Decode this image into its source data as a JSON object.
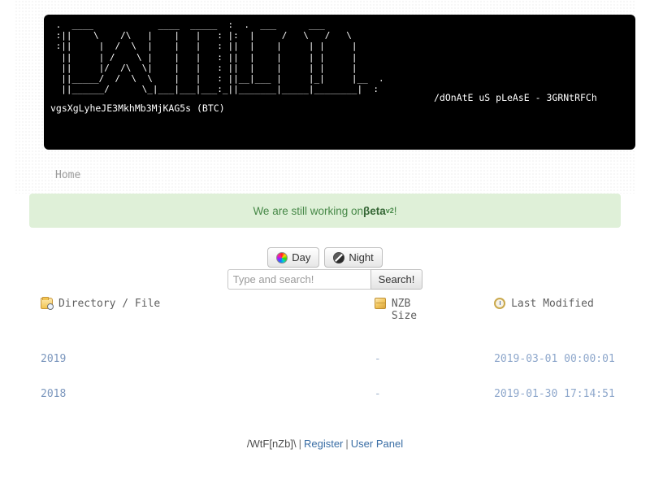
{
  "banner": {
    "ascii_art": " .  ____            ____  _____  :  .  ___      ___ \n :||    \\    /\\   |    |   |   : |:  |     /   \\   /   \\\n :||     |  /  \\  |    |   |   : ||  |    |     | |     |\n  ||     | /    \\ |    |   |   : ||  |    |     | |     |\n  ||     |/  /\\  \\|    |   |   : ||  |    |     | |     |\n  ||_____/  /  \\  \\    |   |   : ||__|___ |     |_|     |__  .\n  ||______/      \\_|___|___|___:_||_______|_____|________|  :",
    "donate_text": "/dOnAtE uS pLeAsE - 3GRNtRFCh",
    "btc_line": "vgsXgLyheJE3MkhMb3MjKAG5s (BTC)",
    "background": "#000000",
    "text_color": "#ffffff"
  },
  "nav": {
    "items": [
      {
        "label": "Home",
        "name": "nav-item-home"
      }
    ]
  },
  "alert": {
    "prefix": "We are still working on ",
    "bold": "βeta",
    "sup": "v2",
    "suffix": "!",
    "background": "#dff0d8",
    "color": "#468847"
  },
  "theme": {
    "day_label": "Day",
    "night_label": "Night",
    "day_icon": "color-wheel-icon",
    "night_icon": "half-moon-icon"
  },
  "search": {
    "placeholder": "Type and search!",
    "value": "",
    "button_label": "Search!"
  },
  "listing": {
    "columns": [
      {
        "label": "Directory / File",
        "icon": "folder-search-icon"
      },
      {
        "label": "NZB Size",
        "icon": "nzb-box-icon"
      },
      {
        "label": "Last Modified",
        "icon": "clock-icon"
      }
    ],
    "rows": [
      {
        "name": "2019",
        "size": "-",
        "modified": "2019-03-01 00:00:01"
      },
      {
        "name": "2018",
        "size": "-",
        "modified": "2019-01-30 17:14:51"
      }
    ]
  },
  "footer": {
    "site_name": "/WtF[nZb]\\",
    "sep": "|",
    "register_label": "Register",
    "user_panel_label": "User Panel"
  }
}
